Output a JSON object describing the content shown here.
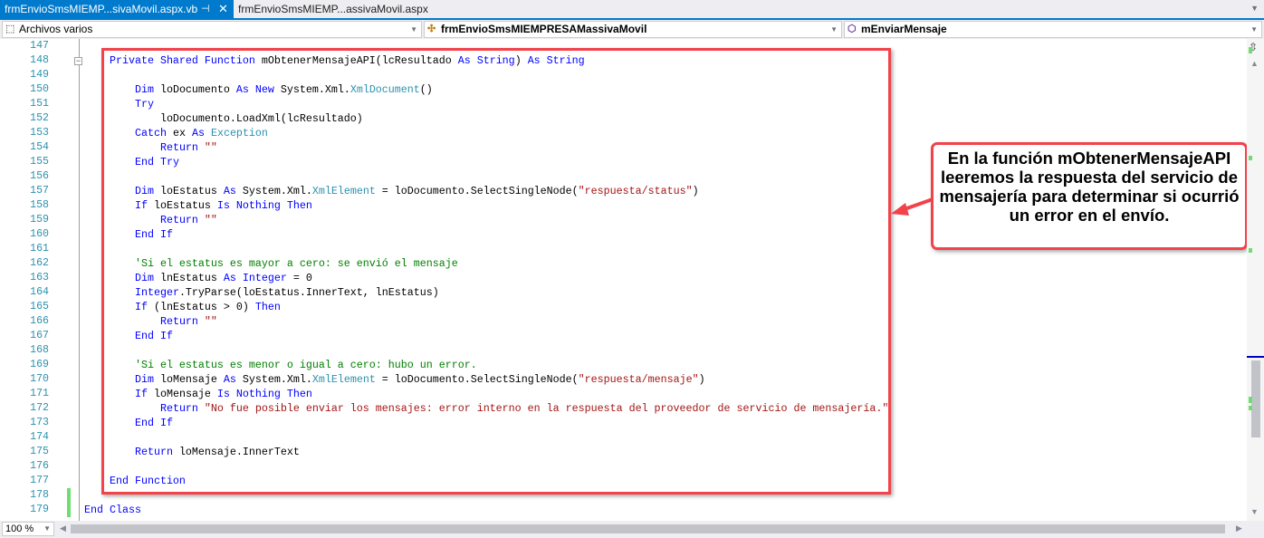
{
  "tabs": [
    {
      "label": "frmEnvioSmsMIEMP...sivaMovil.aspx.vb",
      "active": true
    },
    {
      "label": "frmEnvioSmsMIEMP...assivaMovil.aspx",
      "active": false
    }
  ],
  "nav": {
    "project": "Archivos varios",
    "class": "frmEnvioSmsMIEMPRESAMassivaMovil",
    "member": "mEnviarMensaje"
  },
  "zoom": "100 %",
  "colors": {
    "accent": "#007acc",
    "keyword": "#0000ff",
    "type": "#2b91af",
    "string": "#a31515",
    "comment": "#008000",
    "highlight": "#f2424a"
  },
  "callout": {
    "text": "En la función mObtenerMensajeAPI leeremos la respuesta del servicio de mensajería para determinar si ocurrió un error en el envío."
  },
  "code": {
    "first_line": 147,
    "lines": [
      [],
      [
        [
          "kw",
          "Private Shared Function "
        ],
        [
          "",
          "mObtenerMensajeAPI(lcResultado "
        ],
        [
          "kw",
          "As String"
        ],
        [
          "",
          " ) "
        ],
        [
          "kw",
          "As String"
        ]
      ],
      [],
      [
        [
          "",
          "    "
        ],
        [
          "kw",
          "Dim "
        ],
        [
          "",
          "loDocumento "
        ],
        [
          "kw",
          "As New "
        ],
        [
          "",
          "System.Xml."
        ],
        [
          "ty",
          "XmlDocument"
        ],
        [
          "",
          "()"
        ]
      ],
      [
        [
          "",
          "    "
        ],
        [
          "kw",
          "Try"
        ]
      ],
      [
        [
          "",
          "        loDocumento.LoadXml(lcResultado)"
        ]
      ],
      [
        [
          "",
          "    "
        ],
        [
          "kw",
          "Catch "
        ],
        [
          "",
          "ex "
        ],
        [
          "kw",
          "As "
        ],
        [
          "ty",
          "Exception"
        ]
      ],
      [
        [
          "",
          "        "
        ],
        [
          "kw",
          "Return "
        ],
        [
          "st",
          "\"\""
        ]
      ],
      [
        [
          "",
          "    "
        ],
        [
          "kw",
          "End Try"
        ]
      ],
      [],
      [
        [
          "",
          "    "
        ],
        [
          "kw",
          "Dim "
        ],
        [
          "",
          "loEstatus "
        ],
        [
          "kw",
          "As "
        ],
        [
          "",
          "System.Xml."
        ],
        [
          "ty",
          "XmlElement"
        ],
        [
          "",
          " = loDocumento.SelectSingleNode("
        ],
        [
          "st",
          "\"respuesta/status\""
        ],
        [
          "",
          ")"
        ]
      ],
      [
        [
          "",
          "    "
        ],
        [
          "kw",
          "If "
        ],
        [
          "",
          "loEstatus "
        ],
        [
          "kw",
          "Is Nothing Then"
        ]
      ],
      [
        [
          "",
          "        "
        ],
        [
          "kw",
          "Return "
        ],
        [
          "st",
          "\"\""
        ]
      ],
      [
        [
          "",
          "    "
        ],
        [
          "kw",
          "End If"
        ]
      ],
      [],
      [
        [
          "",
          "    "
        ],
        [
          "cm",
          "'Si el estatus es mayor a cero: se envió el mensaje"
        ]
      ],
      [
        [
          "",
          "    "
        ],
        [
          "kw",
          "Dim "
        ],
        [
          "",
          "lnEstatus "
        ],
        [
          "kw",
          "As Integer "
        ],
        [
          "",
          "= 0"
        ]
      ],
      [
        [
          "",
          "    "
        ],
        [
          "kw",
          "Integer"
        ],
        [
          "",
          ".TryParse(loEstatus.InnerText, lnEstatus)"
        ]
      ],
      [
        [
          "",
          "    "
        ],
        [
          "kw",
          "If "
        ],
        [
          "",
          "(lnEstatus > 0) "
        ],
        [
          "kw",
          "Then"
        ]
      ],
      [
        [
          "",
          "        "
        ],
        [
          "kw",
          "Return "
        ],
        [
          "st",
          "\"\""
        ]
      ],
      [
        [
          "",
          "    "
        ],
        [
          "kw",
          "End If"
        ]
      ],
      [],
      [
        [
          "",
          "    "
        ],
        [
          "cm",
          "'Si el estatus es menor o igual a cero: hubo un error."
        ]
      ],
      [
        [
          "",
          "    "
        ],
        [
          "kw",
          "Dim "
        ],
        [
          "",
          "loMensaje "
        ],
        [
          "kw",
          "As "
        ],
        [
          "",
          "System.Xml."
        ],
        [
          "ty",
          "XmlElement"
        ],
        [
          "",
          " = loDocumento.SelectSingleNode("
        ],
        [
          "st",
          "\"respuesta/mensaje\""
        ],
        [
          "",
          ")"
        ]
      ],
      [
        [
          "",
          "    "
        ],
        [
          "kw",
          "If "
        ],
        [
          "",
          "loMensaje "
        ],
        [
          "kw",
          "Is Nothing Then"
        ]
      ],
      [
        [
          "",
          "        "
        ],
        [
          "kw",
          "Return "
        ],
        [
          "st",
          "\"No fue posible enviar los mensajes: error interno en la respuesta del proveedor de servicio de mensajería.\""
        ]
      ],
      [
        [
          "",
          "    "
        ],
        [
          "kw",
          "End If"
        ]
      ],
      [],
      [
        [
          "",
          "    "
        ],
        [
          "kw",
          "Return "
        ],
        [
          "",
          "loMensaje.InnerText"
        ]
      ],
      [],
      [
        [
          "kw",
          "End Function"
        ]
      ],
      [],
      [
        [
          "kw",
          "End Class"
        ]
      ]
    ]
  }
}
